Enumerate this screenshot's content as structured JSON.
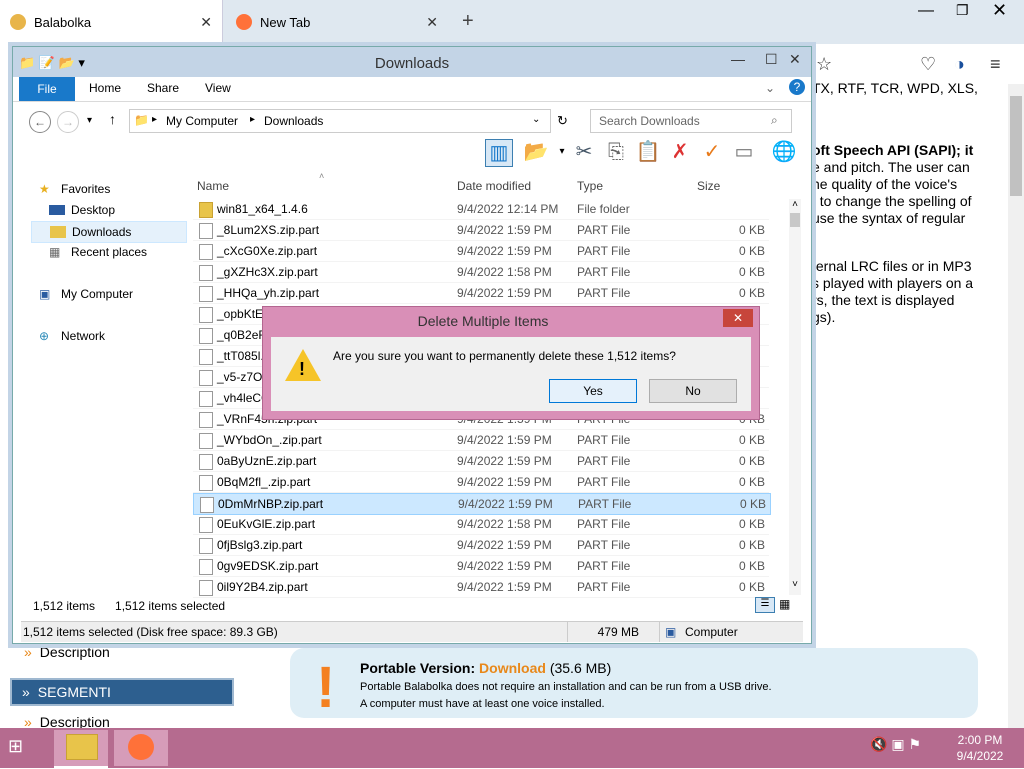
{
  "browser": {
    "tabs": [
      {
        "title": "Balabolka"
      },
      {
        "title": "New Tab"
      }
    ],
    "new_tab_symbol": "+",
    "win_min": "—",
    "win_max": "❐",
    "win_close": "✕"
  },
  "webpage": {
    "text_lines": [
      "TX, RTF, TCR, WPD, XLS,",
      "oft Speech API (SAPI); it",
      "e and pitch. The user can",
      "he quality of the voice's",
      "t to change the spelling of",
      "use the syntax of regular",
      "ternal LRC files or in MP3",
      "s played with players on a",
      "rs, the text is displayed",
      "gs)."
    ],
    "nav": {
      "description": "Description",
      "segmenti": "SEGMENTI",
      "description2": "Description"
    },
    "portable": {
      "title_prefix": "Portable Version: ",
      "title_link": "Download",
      "title_suffix": " (35.6 MB)",
      "line1": "Portable Balabolka does not require an installation and can be run from a USB drive.",
      "line2": "A computer must have at least one voice installed."
    }
  },
  "explorer": {
    "title": "Downloads",
    "ribbon_tabs": [
      "File",
      "Home",
      "Share",
      "View"
    ],
    "address": {
      "part1": "My Computer",
      "part2": "Downloads"
    },
    "search_placeholder": "Search Downloads",
    "navpane": {
      "favorites": "Favorites",
      "desktop": "Desktop",
      "downloads": "Downloads",
      "recent": "Recent places",
      "computer": "My Computer",
      "network": "Network"
    },
    "columns": {
      "name": "Name",
      "date": "Date modified",
      "type": "Type",
      "size": "Size"
    },
    "files": [
      {
        "name": "win81_x64_1.4.6",
        "date": "9/4/2022 12:14 PM",
        "type": "File folder",
        "size": ""
      },
      {
        "name": "_8Lum2XS.zip.part",
        "date": "9/4/2022 1:59 PM",
        "type": "PART File",
        "size": "0 KB"
      },
      {
        "name": "_cXcG0Xe.zip.part",
        "date": "9/4/2022 1:59 PM",
        "type": "PART File",
        "size": "0 KB"
      },
      {
        "name": "_gXZHc3X.zip.part",
        "date": "9/4/2022 1:58 PM",
        "type": "PART File",
        "size": "0 KB"
      },
      {
        "name": "_HHQa_yh.zip.part",
        "date": "9/4/2022 1:59 PM",
        "type": "PART File",
        "size": "0 KB"
      },
      {
        "name": "_opbKtE4",
        "date": "",
        "type": "",
        "size": ""
      },
      {
        "name": "_q0B2eR6",
        "date": "",
        "type": "",
        "size": ""
      },
      {
        "name": "_ttT085l.z",
        "date": "",
        "type": "",
        "size": ""
      },
      {
        "name": "_v5-z7O8",
        "date": "",
        "type": "",
        "size": ""
      },
      {
        "name": "_vh4leCC",
        "date": "",
        "type": "",
        "size": ""
      },
      {
        "name": "_VRnF45h.zip.part",
        "date": "9/4/2022 1:59 PM",
        "type": "PART File",
        "size": "0 KB"
      },
      {
        "name": "_WYbdOn_.zip.part",
        "date": "9/4/2022 1:59 PM",
        "type": "PART File",
        "size": "0 KB"
      },
      {
        "name": "0aByUznE.zip.part",
        "date": "9/4/2022 1:59 PM",
        "type": "PART File",
        "size": "0 KB"
      },
      {
        "name": "0BqM2fl_.zip.part",
        "date": "9/4/2022 1:59 PM",
        "type": "PART File",
        "size": "0 KB"
      },
      {
        "name": "0DmMrNBP.zip.part",
        "date": "9/4/2022 1:59 PM",
        "type": "PART File",
        "size": "0 KB"
      },
      {
        "name": "0EuKvGlE.zip.part",
        "date": "9/4/2022 1:58 PM",
        "type": "PART File",
        "size": "0 KB"
      },
      {
        "name": "0fjBslg3.zip.part",
        "date": "9/4/2022 1:59 PM",
        "type": "PART File",
        "size": "0 KB"
      },
      {
        "name": "0gv9EDSK.zip.part",
        "date": "9/4/2022 1:59 PM",
        "type": "PART File",
        "size": "0 KB"
      },
      {
        "name": "0il9Y2B4.zip.part",
        "date": "9/4/2022 1:59 PM",
        "type": "PART File",
        "size": "0 KB"
      }
    ],
    "selected_index": 14,
    "status_items": "1,512 items",
    "status_selected": "1,512 items selected",
    "status_disk": "1,512 items selected (Disk free space: 89.3 GB)",
    "status_size": "479 MB",
    "status_computer": "Computer"
  },
  "dialog": {
    "title": "Delete Multiple Items",
    "message": "Are you sure you want to permanently delete these 1,512 items?",
    "yes": "Yes",
    "no": "No",
    "close": "✕"
  },
  "taskbar": {
    "time": "2:00 PM",
    "date": "9/4/2022"
  }
}
